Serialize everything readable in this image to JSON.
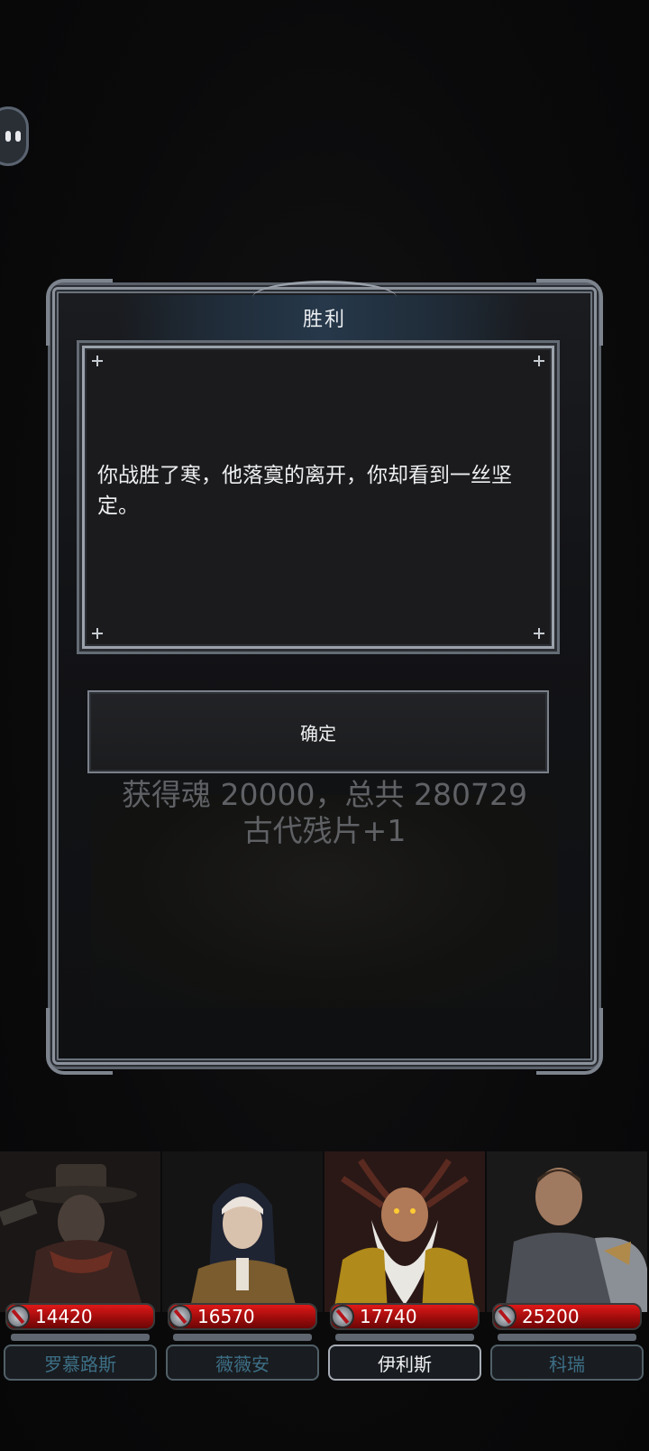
{
  "dialog": {
    "title": "胜利",
    "story_text": "你战胜了寒，他落寞的离开，你却看到一丝坚定。",
    "confirm_label": "确定",
    "reward_line1": "获得魂 20000，总共 280729",
    "reward_line2": "古代残片+1"
  },
  "party": [
    {
      "name": "罗慕路斯",
      "hp": "14420",
      "selected": false
    },
    {
      "name": "薇薇安",
      "hp": "16570",
      "selected": false
    },
    {
      "name": "伊利斯",
      "hp": "17740",
      "selected": true
    },
    {
      "name": "科瑞",
      "hp": "25200",
      "selected": false
    }
  ],
  "colors": {
    "hp_red": "#d41414",
    "frame_silver": "#8b929b",
    "dim_name": "#3d6f86"
  }
}
